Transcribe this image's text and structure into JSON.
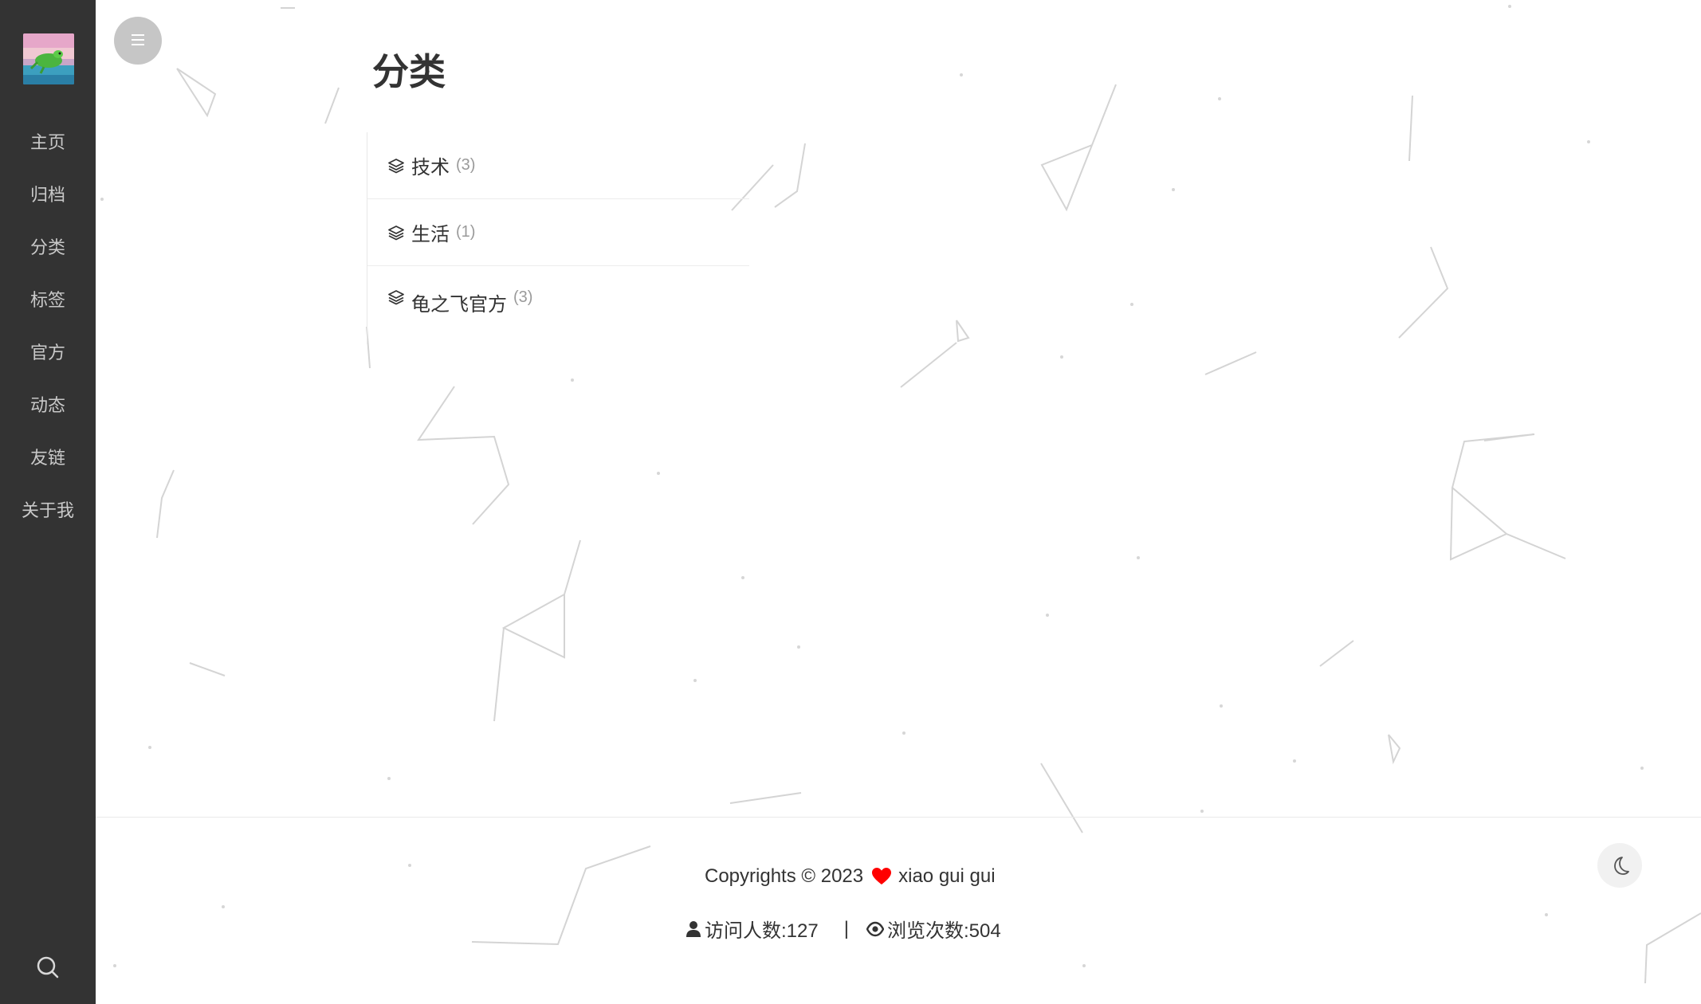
{
  "sidebar": {
    "nav": [
      {
        "label": "主页"
      },
      {
        "label": "归档"
      },
      {
        "label": "分类"
      },
      {
        "label": "标签"
      },
      {
        "label": "官方"
      },
      {
        "label": "动态"
      },
      {
        "label": "友链"
      },
      {
        "label": "关于我"
      }
    ]
  },
  "page": {
    "title": "分类"
  },
  "categories": [
    {
      "name": "技术",
      "count": "(3)"
    },
    {
      "name": "生活",
      "count": "(1)"
    },
    {
      "name": "龟之飞官方",
      "count": "(3)"
    }
  ],
  "footer": {
    "copyright_prefix": "Copyrights © 2023",
    "author": "xiao gui gui",
    "visitors": "访问人数:127",
    "separator": "|",
    "views": "浏览次数:504"
  },
  "icons": {
    "menu": "menu-icon",
    "search": "search-icon",
    "category": "layers-icon",
    "heart": "heart-icon",
    "user": "user-icon",
    "eye": "eye-icon",
    "theme": "moon-icon"
  },
  "colors": {
    "sidebar_bg": "#333333",
    "heart": "#ff0000",
    "toggle_bg": "#c6c6c6"
  }
}
